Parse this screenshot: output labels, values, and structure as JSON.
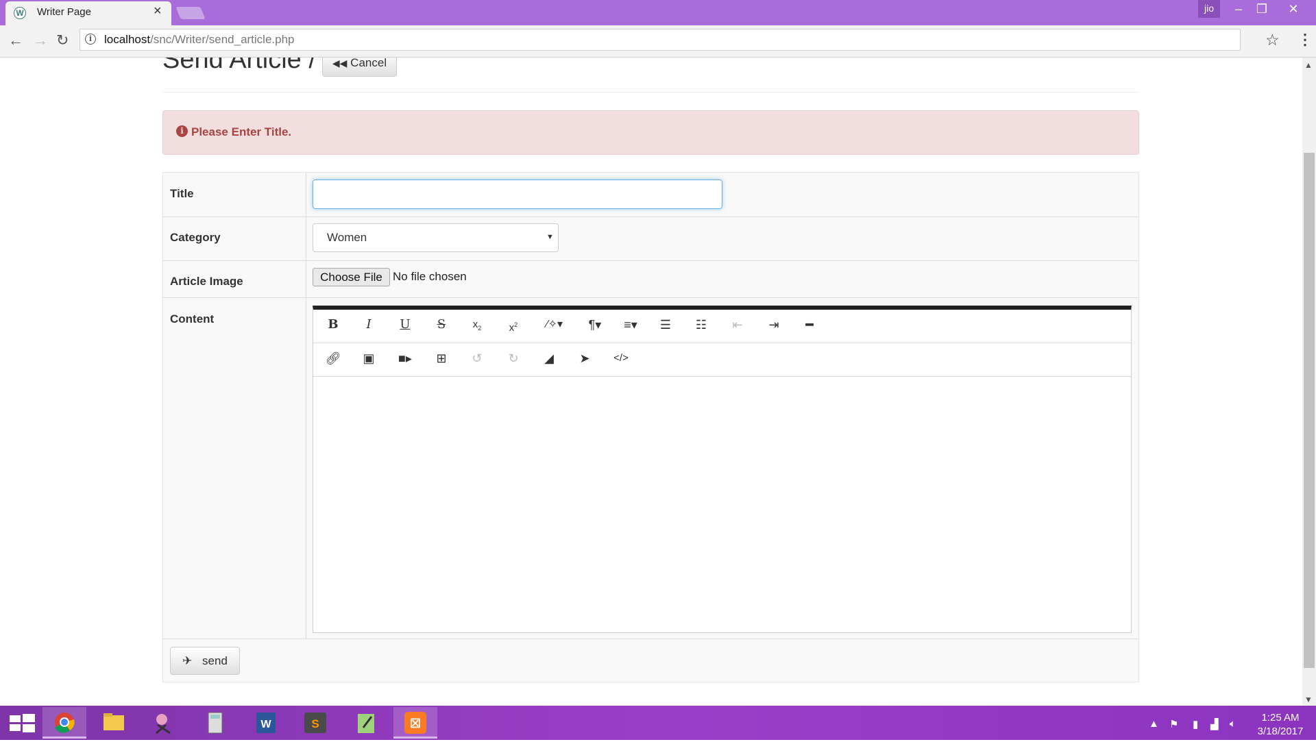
{
  "browser": {
    "tab_title": "Writer Page",
    "tab_favicon_letter": "W",
    "url_host": "localhost",
    "url_path": "/snc/Writer/send_article.php",
    "profile_name": "jio"
  },
  "page": {
    "heading": "Send Article /",
    "cancel_label": "Cancel",
    "alert_message": "Please Enter Title.",
    "form": {
      "title_label": "Title",
      "title_value": "",
      "category_label": "Category",
      "category_selected": "Women",
      "image_label": "Article Image",
      "choose_file_label": "Choose File",
      "file_status": "No file chosen",
      "content_label": "Content"
    },
    "send_label": "send"
  },
  "editor": {
    "toolbar_row1": [
      "bold",
      "italic",
      "underline",
      "strikethrough",
      "subscript",
      "superscript",
      "style",
      "paragraph",
      "align",
      "ordered-list",
      "unordered-list",
      "outdent",
      "indent",
      "horizontal-rule"
    ],
    "toolbar_row2": [
      "link",
      "picture",
      "video",
      "table",
      "undo",
      "redo",
      "eraser",
      "select",
      "code-view"
    ]
  },
  "taskbar": {
    "time": "1:25 AM",
    "date": "3/18/2017"
  },
  "colors": {
    "title_bar": "#a86ddb",
    "alert_bg": "#f2dede",
    "alert_text": "#a94442",
    "taskbar": "#9a3fc8"
  }
}
